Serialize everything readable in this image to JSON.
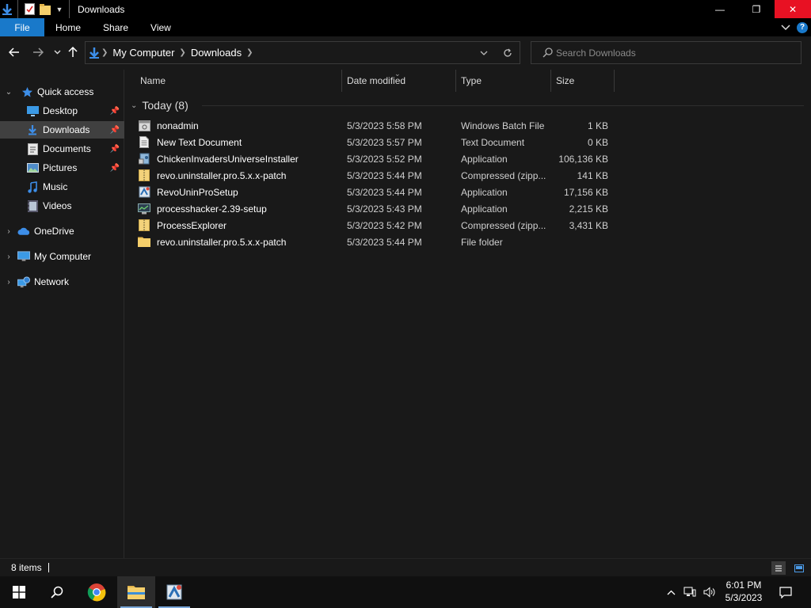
{
  "window": {
    "title": "Downloads",
    "buttons": {
      "minimize": "—",
      "restore": "❐",
      "close": "✕"
    }
  },
  "ribbon": {
    "tabs": [
      "File",
      "Home",
      "Share",
      "View"
    ],
    "help": "?"
  },
  "address": {
    "crumbs": [
      "My Computer",
      "Downloads"
    ]
  },
  "search": {
    "placeholder": "Search Downloads"
  },
  "sidebar": {
    "items": [
      {
        "label": "Quick access",
        "icon": "star-icon",
        "pinned": false
      },
      {
        "label": "Desktop",
        "icon": "desktop-icon",
        "pinned": true
      },
      {
        "label": "Downloads",
        "icon": "download-icon",
        "pinned": true,
        "selected": true
      },
      {
        "label": "Documents",
        "icon": "documents-icon",
        "pinned": true
      },
      {
        "label": "Pictures",
        "icon": "pictures-icon",
        "pinned": true
      },
      {
        "label": "Music",
        "icon": "music-icon",
        "pinned": false
      },
      {
        "label": "Videos",
        "icon": "videos-icon",
        "pinned": false
      },
      {
        "label": "OneDrive",
        "icon": "cloud-icon",
        "pinned": false
      },
      {
        "label": "My Computer",
        "icon": "computer-icon",
        "pinned": false
      },
      {
        "label": "Network",
        "icon": "network-icon",
        "pinned": false
      }
    ]
  },
  "columns": {
    "name": "Name",
    "date": "Date modified",
    "type": "Type",
    "size": "Size"
  },
  "group": {
    "label": "Today (8)"
  },
  "files": [
    {
      "name": "nonadmin",
      "date": "5/3/2023 5:58 PM",
      "type": "Windows Batch File",
      "size": "1 KB",
      "icon": "batch-file-icon"
    },
    {
      "name": "New Text Document",
      "date": "5/3/2023 5:57 PM",
      "type": "Text Document",
      "size": "0 KB",
      "icon": "text-file-icon"
    },
    {
      "name": "ChickenInvadersUniverseInstaller",
      "date": "5/3/2023 5:52 PM",
      "type": "Application",
      "size": "106,136 KB",
      "icon": "installer-icon"
    },
    {
      "name": "revo.uninstaller.pro.5.x.x-patch",
      "date": "5/3/2023 5:44 PM",
      "type": "Compressed (zipp...",
      "size": "141 KB",
      "icon": "zip-folder-icon"
    },
    {
      "name": "RevoUninProSetup",
      "date": "5/3/2023 5:44 PM",
      "type": "Application",
      "size": "17,156 KB",
      "icon": "setup-icon"
    },
    {
      "name": "processhacker-2.39-setup",
      "date": "5/3/2023 5:43 PM",
      "type": "Application",
      "size": "2,215 KB",
      "icon": "app-icon"
    },
    {
      "name": "ProcessExplorer",
      "date": "5/3/2023 5:42 PM",
      "type": "Compressed (zipp...",
      "size": "3,431 KB",
      "icon": "zip-folder-icon"
    },
    {
      "name": "revo.uninstaller.pro.5.x.x-patch",
      "date": "5/3/2023 5:44 PM",
      "type": "File folder",
      "size": "",
      "icon": "folder-icon"
    }
  ],
  "status": {
    "count": "8 items"
  },
  "taskbar": {
    "clock_time": "6:01 PM",
    "clock_date": "5/3/2023"
  },
  "colors": {
    "accent": "#1979ca",
    "close": "#e81123",
    "background": "#191919",
    "selected": "#404040"
  }
}
